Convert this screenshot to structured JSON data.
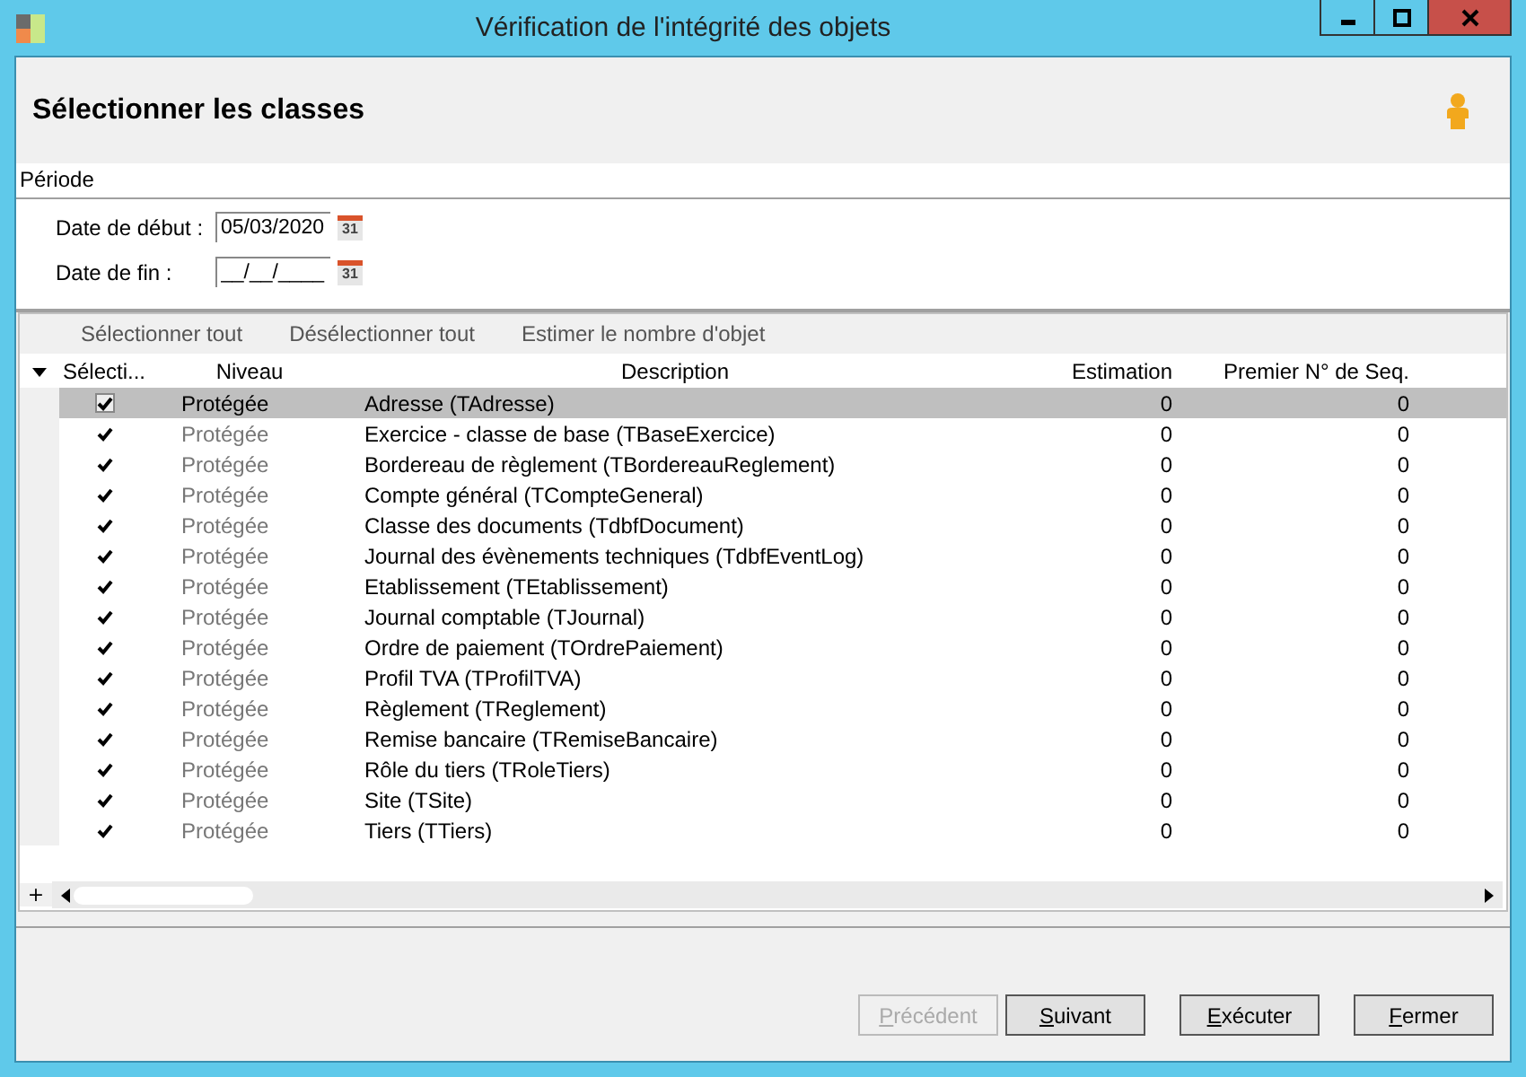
{
  "window": {
    "title": "Vérification de l'intégrité des objets"
  },
  "header": {
    "title": "Sélectionner les classes"
  },
  "period": {
    "label": "Période",
    "fields": [
      {
        "label": "Date de début :",
        "value": "05/03/2020",
        "calendar_text": "31"
      },
      {
        "label": "Date de fin :",
        "value": "__/__/____",
        "calendar_text": "31"
      }
    ]
  },
  "toolbar": [
    "Sélectionner tout",
    "Désélectionner tout",
    "Estimer le nombre d'objet"
  ],
  "table": {
    "columns": [
      "Sélecti...",
      "Niveau",
      "Description",
      "Estimation",
      "Premier N° de Seq."
    ],
    "rows": [
      {
        "checked": true,
        "selected": true,
        "level": "Protégée",
        "description": "Adresse (TAdresse)",
        "estimation": "0",
        "first_seq": "0"
      },
      {
        "checked": true,
        "selected": false,
        "level": "Protégée",
        "description": "Exercice - classe de base (TBaseExercice)",
        "estimation": "0",
        "first_seq": "0"
      },
      {
        "checked": true,
        "selected": false,
        "level": "Protégée",
        "description": "Bordereau de règlement (TBordereauReglement)",
        "estimation": "0",
        "first_seq": "0"
      },
      {
        "checked": true,
        "selected": false,
        "level": "Protégée",
        "description": "Compte général (TCompteGeneral)",
        "estimation": "0",
        "first_seq": "0"
      },
      {
        "checked": true,
        "selected": false,
        "level": "Protégée",
        "description": "Classe des documents (TdbfDocument)",
        "estimation": "0",
        "first_seq": "0"
      },
      {
        "checked": true,
        "selected": false,
        "level": "Protégée",
        "description": "Journal des évènements techniques (TdbfEventLog)",
        "estimation": "0",
        "first_seq": "0"
      },
      {
        "checked": true,
        "selected": false,
        "level": "Protégée",
        "description": "Etablissement (TEtablissement)",
        "estimation": "0",
        "first_seq": "0"
      },
      {
        "checked": true,
        "selected": false,
        "level": "Protégée",
        "description": "Journal comptable (TJournal)",
        "estimation": "0",
        "first_seq": "0"
      },
      {
        "checked": true,
        "selected": false,
        "level": "Protégée",
        "description": "Ordre de paiement (TOrdrePaiement)",
        "estimation": "0",
        "first_seq": "0"
      },
      {
        "checked": true,
        "selected": false,
        "level": "Protégée",
        "description": "Profil TVA (TProfilTVA)",
        "estimation": "0",
        "first_seq": "0"
      },
      {
        "checked": true,
        "selected": false,
        "level": "Protégée",
        "description": "Règlement (TReglement)",
        "estimation": "0",
        "first_seq": "0"
      },
      {
        "checked": true,
        "selected": false,
        "level": "Protégée",
        "description": "Remise bancaire (TRemiseBancaire)",
        "estimation": "0",
        "first_seq": "0"
      },
      {
        "checked": true,
        "selected": false,
        "level": "Protégée",
        "description": "Rôle du tiers (TRoleTiers)",
        "estimation": "0",
        "first_seq": "0"
      },
      {
        "checked": true,
        "selected": false,
        "level": "Protégée",
        "description": "Site (TSite)",
        "estimation": "0",
        "first_seq": "0"
      },
      {
        "checked": true,
        "selected": false,
        "level": "Protégée",
        "description": "Tiers (TTiers)",
        "estimation": "0",
        "first_seq": "0"
      }
    ],
    "expand_text": "+"
  },
  "buttons": [
    {
      "label": "Précédent",
      "disabled": true
    },
    {
      "label": "Suivant",
      "disabled": false
    },
    {
      "label": "Exécuter",
      "disabled": false
    },
    {
      "label": "Fermer",
      "disabled": false
    }
  ]
}
